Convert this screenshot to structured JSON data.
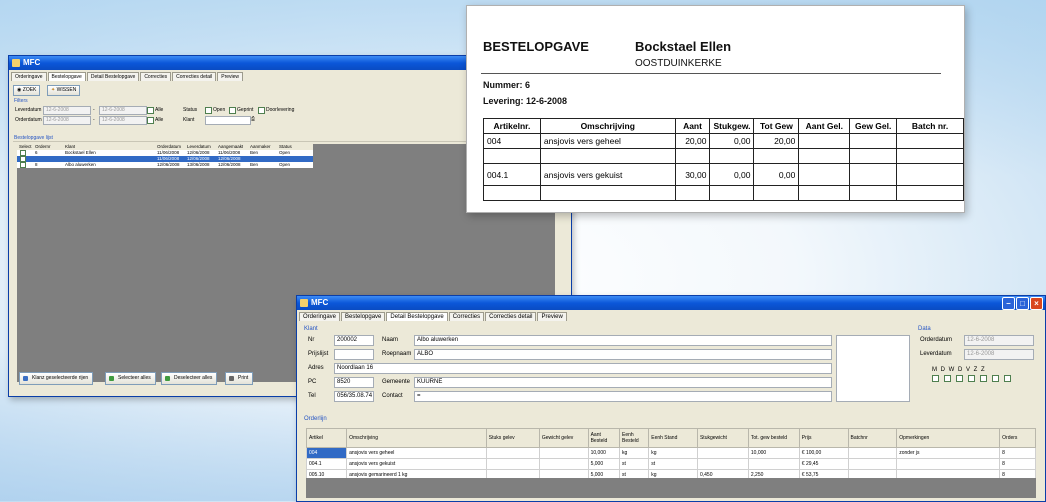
{
  "window1": {
    "title": "MFC",
    "tabs": [
      "Orderingave",
      "Bestelopgave",
      "Detail Bestelopgave",
      "Correcties",
      "Correcties detail",
      "Preview"
    ],
    "active_tab": 1,
    "buttons": {
      "zoek": "ZOEK",
      "wissen": "WISSEN"
    },
    "filter_title": "Filters",
    "filters": {
      "leverdatum_label": "Leverdatum",
      "leverdatum_from": "12-6-2008",
      "leverdatum_to": "12-6-2008",
      "alle_label": "Alle",
      "orderdatum_label": "Orderdatum",
      "orderdatum_from": "12-6-2008",
      "orderdatum_to": "12-6-2008",
      "alle_label2": "Alle",
      "status_label": "Status",
      "open_label": "Open",
      "geprint_label": "Geprint",
      "doorlevering_label": "Doorlevering",
      "klant_label": "Klant"
    },
    "list_title": "Bestelopgave lijst",
    "columns": [
      "Select",
      "Ordernr",
      "Klant",
      "Orderdatum",
      "Leverdatum",
      "Aangemaakt",
      "Aanmaker",
      "Status"
    ],
    "rows": [
      [
        "",
        "6",
        "Bockstael Ellen",
        "11/06/2008",
        "12/06/2008",
        "11/06/2008",
        "Ben",
        "Open"
      ],
      [
        "",
        "",
        "",
        "11/06/2008",
        "12/06/2008",
        "12/06/2008",
        "",
        ""
      ],
      [
        "",
        "8",
        "Albo aluwerken",
        "12/06/2008",
        "13/06/2008",
        "12/06/2008",
        "Ben",
        "Open"
      ]
    ],
    "bottom_buttons": [
      "Klanz geselecteerde rijen",
      "Selecteer alles",
      "Deselecteer alles",
      "Print"
    ]
  },
  "window2": {
    "title": "BESTELOPGAVE",
    "name": "Bockstael Ellen",
    "town": "OOSTDUINKERKE",
    "nummer_label": "Nummer:",
    "nummer": "6",
    "levering_label": "Levering:",
    "levering": "12-6-2008",
    "columns": [
      "Artikelnr.",
      "Omschrijving",
      "Aant",
      "Stukgew.",
      "Tot Gew",
      "Aant Gel.",
      "Gew Gel.",
      "Batch nr."
    ],
    "rows": [
      [
        "004",
        "ansjovis vers geheel",
        "20,00",
        "0,00",
        "20,00",
        "",
        "",
        ""
      ],
      [
        "004.1",
        "ansjovis vers gekuist",
        "30,00",
        "0,00",
        "0,00",
        "",
        "",
        ""
      ]
    ]
  },
  "window3": {
    "title": "MFC",
    "tabs": [
      "Orderingave",
      "Bestelopgave",
      "Detail Bestelopgave",
      "Correcties",
      "Correcties detail",
      "Preview"
    ],
    "active_tab": 2,
    "klant_title": "Klant",
    "klant": {
      "nr_label": "Nr",
      "nr": "200002",
      "naam_label": "Naam",
      "naam": "Albo aluwerken",
      "prijslijst_label": "Prijslijst",
      "prijslijst": "",
      "roepnaam_label": "Roepnaam",
      "roepnaam": "ALBO",
      "adres_label": "Adres",
      "adres": "Noordlaan 16",
      "pc_label": "PC",
      "pc": "8520",
      "gemeente_label": "Gemeente",
      "gemeente": "KUURNE",
      "tel_label": "Tel",
      "tel": "056/35.08.74",
      "contact_label": "Contact",
      "contact": "="
    },
    "data_title": "Data",
    "data": {
      "orderdatum_label": "Orderdatum",
      "orderdatum": "12-6-2008",
      "leverdatum_label": "Leverdatum",
      "leverdatum": "12-6-2008",
      "days": "M D W D V Z Z"
    },
    "orderlijn_title": "Orderlijn",
    "columns": [
      "Artikel",
      "Omschrijving",
      "Stuks gelev",
      "Gewicht gelev",
      "Aant Besteld",
      "Eenh Besteld",
      "Eenh Stand",
      "Stukgewicht",
      "Tot. gew besteld",
      "Prijs",
      "Batchnr",
      "Opmerkingen",
      "Orders"
    ],
    "rows": [
      [
        "004",
        "ansjovis vers geheel",
        "",
        "",
        "10,000",
        "kg",
        "kg",
        "",
        "10,000",
        "€ 100,00",
        "",
        "zonder js",
        "8"
      ],
      [
        "004.1",
        "ansjovis vers gekuist",
        "",
        "",
        "5,000",
        "st",
        "st",
        "",
        "",
        "€ 29,45",
        "",
        "",
        "8"
      ],
      [
        "005.10",
        "ansjovis gemarineerd 1 kg",
        "",
        "",
        "5,000",
        "st",
        "kg",
        "0,450",
        "2,250",
        "€ 53,75",
        "",
        "",
        "8"
      ]
    ]
  }
}
